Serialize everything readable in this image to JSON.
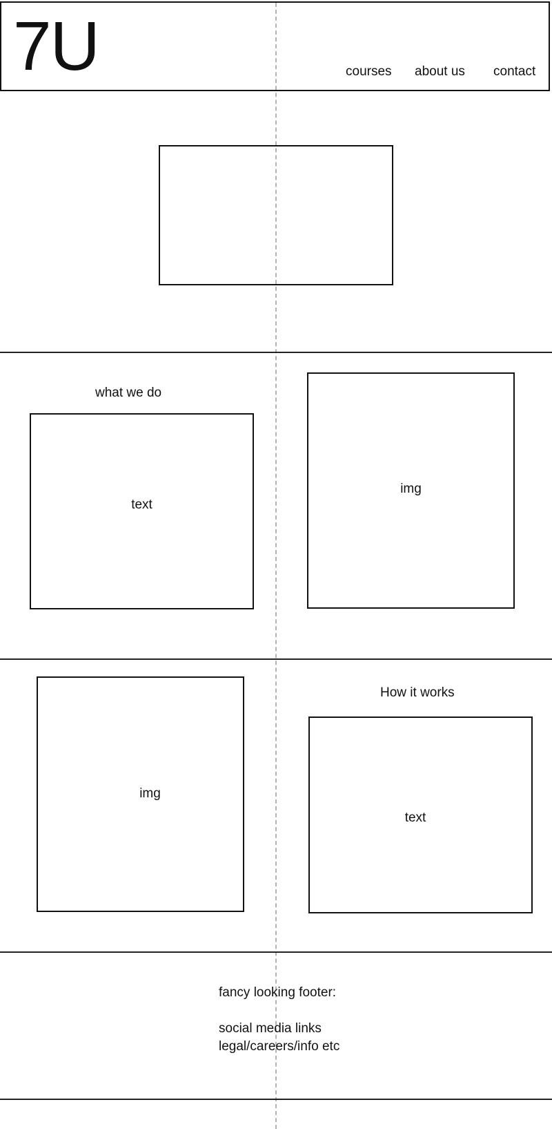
{
  "header": {
    "logo": "7U",
    "nav": [
      "courses",
      "about us",
      "contact"
    ]
  },
  "section_what": {
    "heading": "what we do",
    "text_box_label": "text",
    "img_box_label": "img"
  },
  "section_how": {
    "heading": "How it works",
    "img_box_label": "img",
    "text_box_label": "text"
  },
  "footer": {
    "title": "fancy looking footer:",
    "lines": [
      "social media links",
      "legal/careers/info etc"
    ]
  }
}
